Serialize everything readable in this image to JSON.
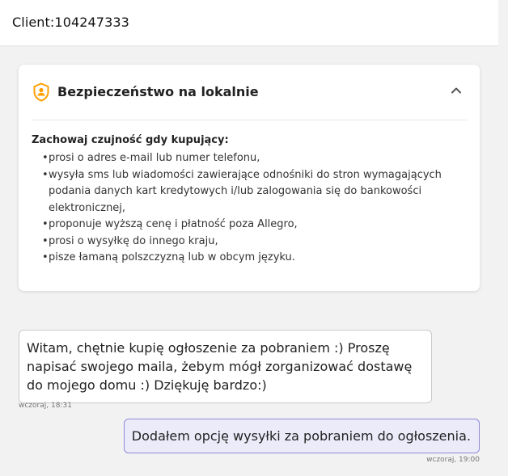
{
  "header": {
    "title": "Client:104247333"
  },
  "safety_card": {
    "icon": "shield-person-icon",
    "title": "Bezpieczeństwo na lokalnie",
    "collapse_icon": "chevron-up-icon",
    "warning_title": "Zachowaj czujność gdy kupujący:",
    "items": [
      "prosi o adres e-mail lub numer telefonu,",
      "wysyła sms lub wiadomości zawierające odnośniki do stron wymagających podania danych kart kredytowych i/lub zalogowania się do bankowości elektronicznej,",
      "proponuje wyższą cenę i płatność poza Allegro,",
      "prosi o wysyłkę do innego kraju,",
      "pisze łamaną polszczyzną lub w obcym języku."
    ],
    "bullet": "•",
    "accent_color": "#ff9f00"
  },
  "messages": [
    {
      "direction": "incoming",
      "text": "Witam, chętnie kupię ogłoszenie za pobraniem :) Proszę napisać swojego maila, żebym mógł zorganizować dostawę do mojego domu :) Dziękuję bardzo:)",
      "time": "wczoraj, 18:31"
    },
    {
      "direction": "outgoing",
      "text": "Dodałem opcję wysyłki za pobraniem do ogłoszenia.",
      "time": "wczoraj, 19:00",
      "bubble_color": "#ecebfa",
      "border_color": "#8f8ad6"
    }
  ]
}
